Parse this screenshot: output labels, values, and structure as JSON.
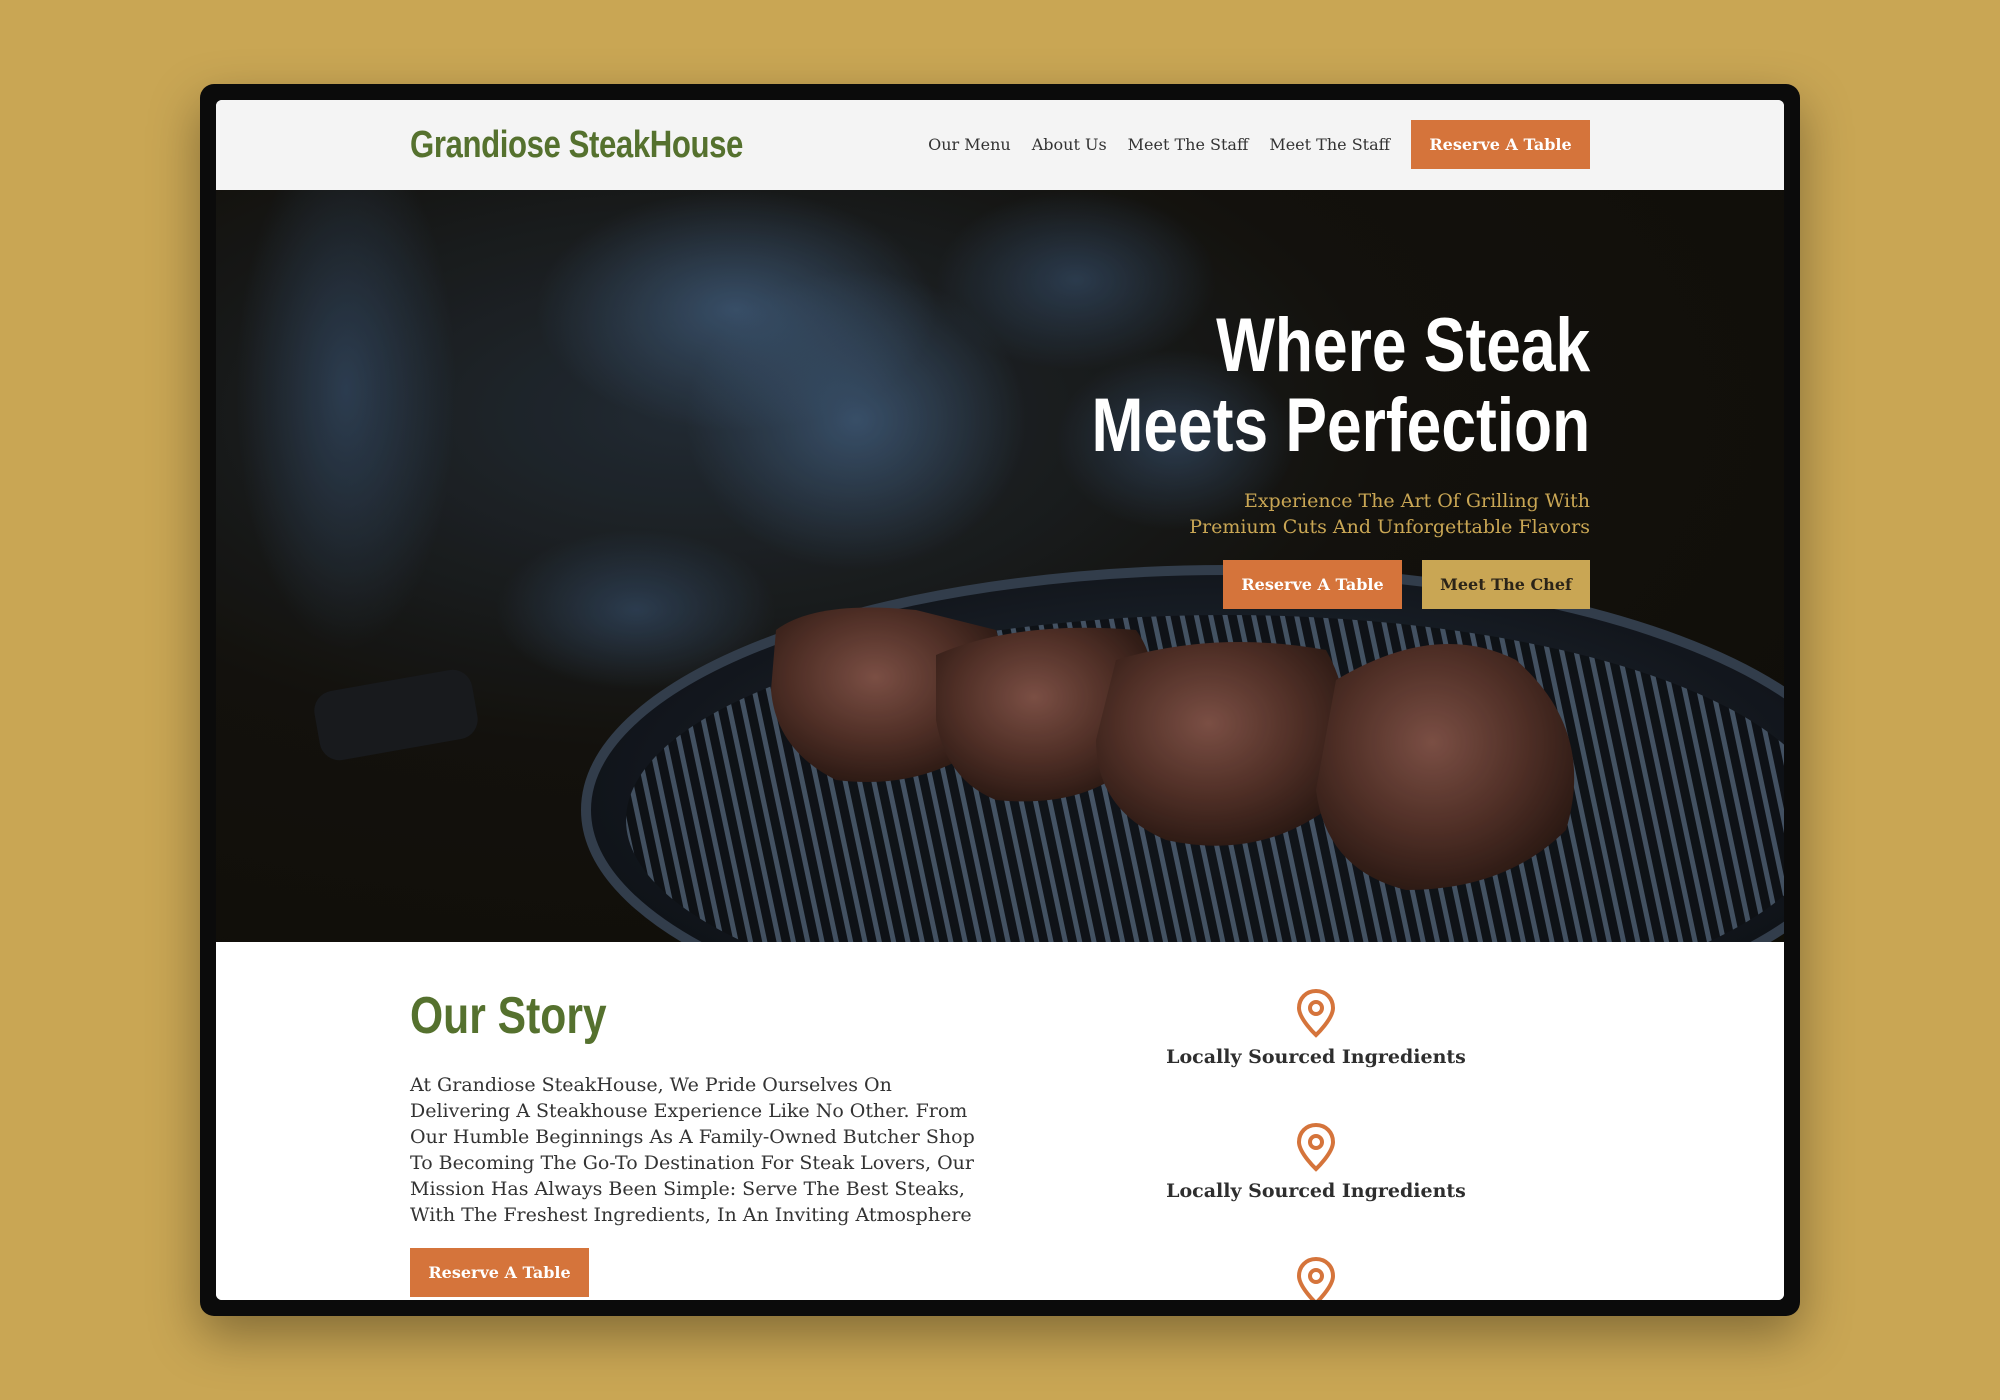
{
  "brand": {
    "name": "Grandiose SteakHouse"
  },
  "nav": {
    "links": [
      "Our Menu",
      "About Us",
      "Meet The Staff",
      "Meet The Staff"
    ],
    "cta": "Reserve A Table"
  },
  "hero": {
    "title_line1": "Where Steak",
    "title_line2": "Meets Perfection",
    "subtitle_line1": "Experience The Art Of Grilling With",
    "subtitle_line2": "Premium Cuts And Unforgettable Flavors",
    "primary_button": "Reserve A Table",
    "secondary_button": "Meet The Chef",
    "image": "steaks-on-grill"
  },
  "story": {
    "title": "Our Story",
    "body": "At Grandiose SteakHouse, We Pride Ourselves On Delivering A Steakhouse Experience Like No Other. From Our Humble Beginnings As A Family-Owned Butcher Shop To Becoming The Go-To Destination For Steak Lovers, Our Mission Has Always Been Simple: Serve The Best Steaks, With The Freshest Ingredients, In An Inviting Atmosphere",
    "button": "Reserve A Table"
  },
  "features": [
    {
      "icon": "location-pin-icon",
      "label": "Locally Sourced Ingredients"
    },
    {
      "icon": "location-pin-icon",
      "label": "Locally Sourced Ingredients"
    },
    {
      "icon": "location-pin-icon",
      "label": ""
    }
  ],
  "colors": {
    "background": "#c9a654",
    "accent_orange": "#d5743b",
    "accent_gold": "#c9a654",
    "brand_green": "#55712e"
  }
}
